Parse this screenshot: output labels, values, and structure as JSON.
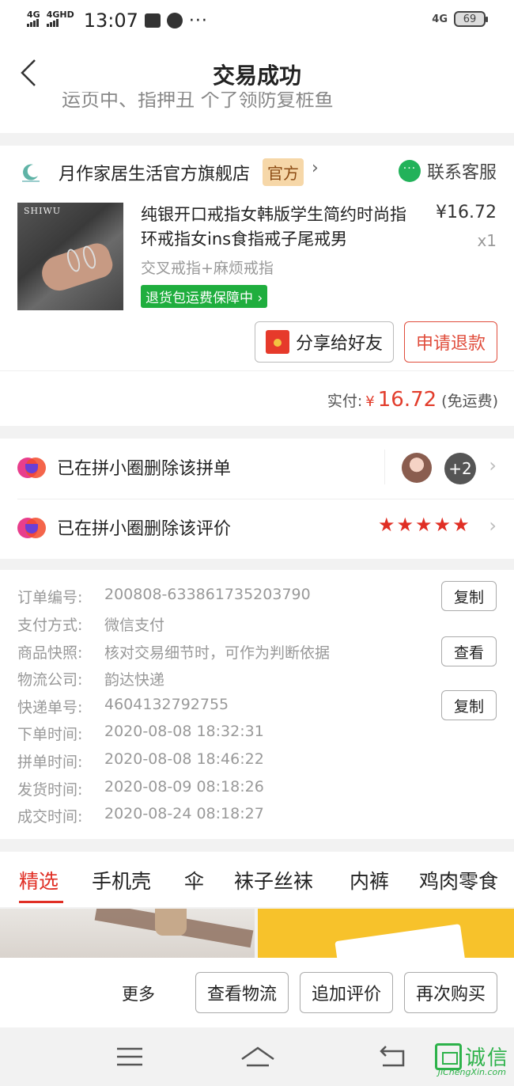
{
  "status_bar": {
    "network1": "4G",
    "network2": "4GHD",
    "time": "13:07",
    "dots": "···",
    "network_right": "4G",
    "battery": "69"
  },
  "header": {
    "title": "交易成功",
    "cut_off_text": "运页中、指押丑 个了领防复桩鱼"
  },
  "store": {
    "name": "月作家居生活官方旗舰店",
    "badge": "官方",
    "chevron": "›",
    "service_label": "联系客服"
  },
  "product": {
    "title": "纯银开口戒指女韩版学生简约时尚指环戒指女ins食指戒子尾戒男",
    "price": "¥16.72",
    "quantity": "x1",
    "spec": "交叉戒指+麻烦戒指",
    "guarantee": "退货包运费保障中 ›",
    "image_brand": "SHIWU"
  },
  "actions": {
    "share_label": "分享给好友",
    "refund_label": "申请退款"
  },
  "payment": {
    "label": "实付:",
    "currency": "¥",
    "amount": "16.72",
    "note": "(免运费)"
  },
  "group_rows": [
    {
      "text": "已在拼小圈删除该拼单",
      "more_count": "+2"
    },
    {
      "text": "已在拼小圈删除该评价",
      "rating": 5
    }
  ],
  "order_info": [
    {
      "label": "订单编号:",
      "value": "200808-633861735203790",
      "button": "复制"
    },
    {
      "label": "支付方式:",
      "value": "微信支付"
    },
    {
      "label": "商品快照:",
      "value": "核对交易细节时，可作为判断依据",
      "button": "查看"
    },
    {
      "label": "物流公司:",
      "value": "韵达快递"
    },
    {
      "label": "快递单号:",
      "value": "4604132792755",
      "button": "复制"
    },
    {
      "label": "下单时间:",
      "value": "2020-08-08 18:32:31"
    },
    {
      "label": "拼单时间:",
      "value": "2020-08-08 18:46:22"
    },
    {
      "label": "发货时间:",
      "value": "2020-08-09 08:18:26"
    },
    {
      "label": "成交时间:",
      "value": "2020-08-24 08:18:27"
    }
  ],
  "tabs": [
    "精选",
    "手机壳",
    "伞",
    "袜子丝袜",
    "内裤",
    "鸡肉零食"
  ],
  "bottom_bar": {
    "more": "更多",
    "logistics": "查看物流",
    "add_review": "追加评价",
    "buy_again": "再次购买"
  },
  "watermark": {
    "text": "诚信",
    "sub": "JiChengXin.com"
  },
  "colors": {
    "accent_red": "#e02e24",
    "guarantee_green": "#1fae3e",
    "service_green": "#22b25a"
  }
}
